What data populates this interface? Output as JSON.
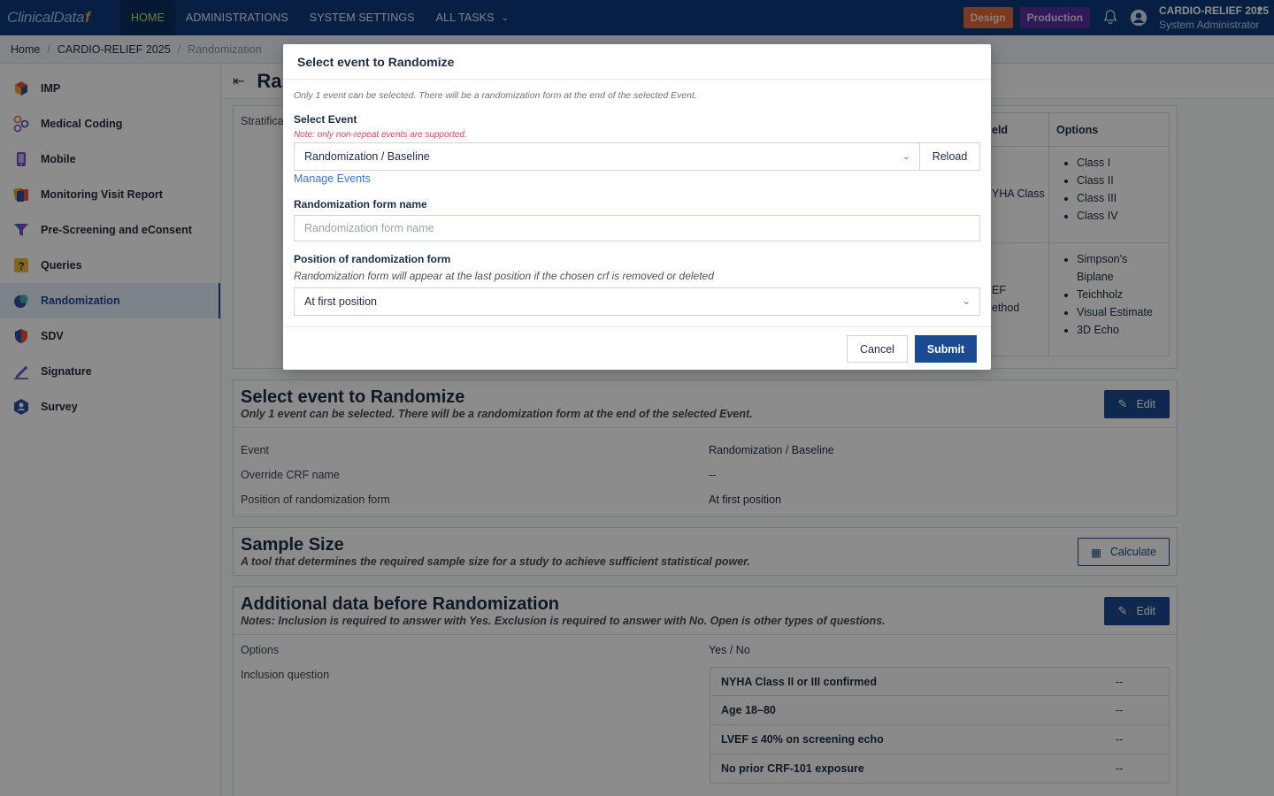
{
  "topbar": {
    "logo_text": "ClinicalData",
    "logo_mark": "f",
    "nav": [
      {
        "label": "HOME",
        "active": true
      },
      {
        "label": "ADMINISTRATIONS"
      },
      {
        "label": "SYSTEM SETTINGS"
      },
      {
        "label": "ALL TASKS",
        "dropdown": true
      }
    ],
    "badge_design": "Design",
    "badge_production": "Production",
    "study_name": "CARDIO-RELIEF 2025",
    "user_role": "System Administrator"
  },
  "breadcrumb": [
    "Home",
    "CARDIO-RELIEF 2025",
    "Randomization"
  ],
  "sidebar": {
    "items": [
      {
        "label": "IMP",
        "icon": "cube-icon"
      },
      {
        "label": "Medical Coding",
        "icon": "molecule-icon"
      },
      {
        "label": "Mobile",
        "icon": "phone-icon"
      },
      {
        "label": "Monitoring Visit Report",
        "icon": "cards-icon"
      },
      {
        "label": "Pre-Screening and eConsent",
        "icon": "funnel-icon"
      },
      {
        "label": "Queries",
        "icon": "question-icon"
      },
      {
        "label": "Randomization",
        "icon": "shuffle-icon",
        "active": true
      },
      {
        "label": "SDV",
        "icon": "shield-icon"
      },
      {
        "label": "Signature",
        "icon": "pen-icon"
      },
      {
        "label": "Survey",
        "icon": "survey-icon"
      }
    ]
  },
  "main": {
    "title": "Ra",
    "strat": {
      "label": "Stratifica",
      "col_field": "eld",
      "col_options": "Options",
      "row1_field": "YHA Class",
      "row1_options": [
        "Class I",
        "Class II",
        "Class III",
        "Class IV"
      ],
      "row2_field_line1": "EF",
      "row2_field_line2": "ethod",
      "row2_options": [
        "Simpson's",
        "Biplane",
        "Teichholz",
        "Visual Estimate",
        "3D Echo"
      ]
    },
    "event_card": {
      "title": "Select event to Randomize",
      "subtitle": "Only 1 event can be selected. There will be a randomization form at the end of the selected Event.",
      "edit_label": "Edit",
      "rows": [
        {
          "label": "Event",
          "value": "Randomization / Baseline"
        },
        {
          "label": "Override CRF name",
          "value": "--"
        },
        {
          "label": "Position of randomization form",
          "value": "At first position"
        }
      ]
    },
    "sample_card": {
      "title": "Sample Size",
      "subtitle": "A tool that determines the required sample size for a study to achieve sufficient statistical power.",
      "calc_label": "Calculate"
    },
    "additional_card": {
      "title": "Additional data before Randomization",
      "subtitle": "Notes: Inclusion is required to answer with Yes. Exclusion is required to answer with No. Open is other types of questions.",
      "edit_label": "Edit",
      "options_label": "Options",
      "options_value": "Yes / No",
      "inclusion_label": "Inclusion question",
      "inclusion_rows": [
        {
          "q": "NYHA Class II or III confirmed",
          "v": "--"
        },
        {
          "q": "Age 18–80",
          "v": "--"
        },
        {
          "q": "LVEF ≤ 40% on screening echo",
          "v": "--"
        },
        {
          "q": "No prior CRF-101 exposure",
          "v": "--"
        }
      ]
    }
  },
  "modal": {
    "title": "Select event to Randomize",
    "note": "Only 1 event can be selected. There will be a randomization form at the end of the selected Event.",
    "select_event_label": "Select Event",
    "warning": "Note: only non-repeat events are supported.",
    "event_value": "Randomization / Baseline",
    "reload_label": "Reload",
    "manage_link": "Manage Events",
    "form_name_label": "Randomization form name",
    "form_name_placeholder": "Randomization form name",
    "position_label": "Position of randomization form",
    "position_hint": "Randomization form will appear at the last position if the chosen crf is removed or deleted",
    "position_value": "At first position",
    "cancel_label": "Cancel",
    "submit_label": "Submit"
  }
}
